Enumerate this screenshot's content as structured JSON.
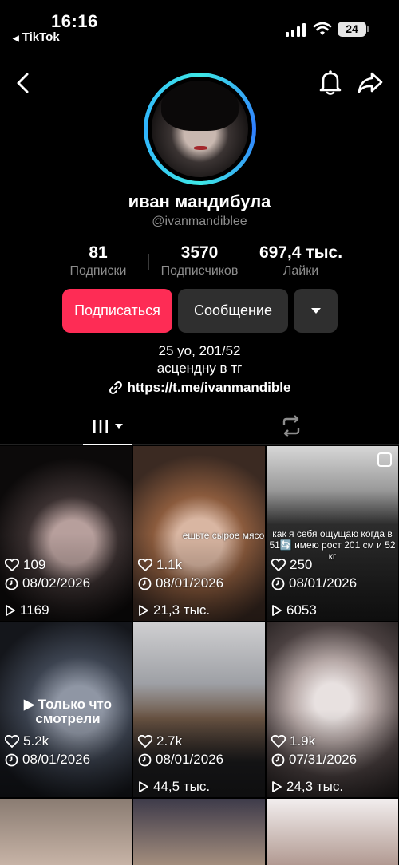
{
  "status_bar": {
    "time": "16:16",
    "back_app": "TikTok",
    "battery": "24"
  },
  "profile": {
    "display_name": "иван мандибула",
    "username": "@ivanmandiblee",
    "stats": [
      {
        "value": "81",
        "label": "Подписки"
      },
      {
        "value": "3570",
        "label": "Подписчиков"
      },
      {
        "value": "697,4 тыс.",
        "label": "Лайки"
      }
    ],
    "buttons": {
      "follow": "Подписаться",
      "message": "Сообщение"
    },
    "bio_line1": "25 yo, 201/52",
    "bio_line2": "асцендну в тг",
    "link": "https://t.me/ivanmandible"
  },
  "colors": {
    "accent": "#fe2c55",
    "button_dark": "#2f2f2f",
    "muted": "#8d8d8d",
    "ring": "#3ee8e6"
  },
  "videos": [
    {
      "likes": "109",
      "date": "08/02/2026",
      "views": "1169",
      "caption": ""
    },
    {
      "likes": "1.1k",
      "date": "08/01/2026",
      "views": "21,3 тыс.",
      "caption": "ешьте сырое мясо"
    },
    {
      "likes": "250",
      "date": "08/01/2026",
      "views": "6053",
      "caption": "как я себя ощущаю когда в 51🔄 имею рост 201 см и 52 кг"
    },
    {
      "likes": "5.2k",
      "date": "08/01/2026",
      "views": "",
      "caption": "",
      "badge": "Только что смотрели"
    },
    {
      "likes": "2.7k",
      "date": "08/01/2026",
      "views": "44,5 тыс.",
      "caption": ""
    },
    {
      "likes": "1.9k",
      "date": "07/31/2026",
      "views": "24,3 тыс.",
      "caption": ""
    }
  ]
}
